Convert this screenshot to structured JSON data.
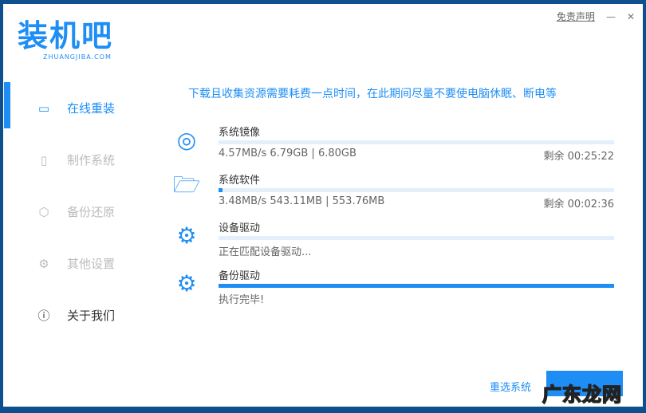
{
  "logo": {
    "text": "装机吧",
    "domain": "ZHUANGJIBA.COM"
  },
  "header": {
    "disclaimer": "免责声明",
    "minimize": "—",
    "close": "✕"
  },
  "sidebar": {
    "items": [
      {
        "label": "在线重装",
        "icon": "monitor-icon"
      },
      {
        "label": "制作系统",
        "icon": "usb-icon"
      },
      {
        "label": "备份还原",
        "icon": "shield-icon"
      },
      {
        "label": "其他设置",
        "icon": "gear-icon"
      },
      {
        "label": "关于我们",
        "icon": "info-icon"
      }
    ]
  },
  "notice": "下载且收集资源需要耗费一点时间，在此期间尽量不要使电脑休眠、断电等",
  "items": [
    {
      "name": "系统镜像",
      "info": "4.57MB/s 6.79GB | 6.80GB",
      "remain": "剩余 00:25:22",
      "progress": 0
    },
    {
      "name": "系统软件",
      "info": "3.48MB/s 543.11MB | 553.76MB",
      "remain": "剩余 00:02:36",
      "progress": 1
    },
    {
      "name": "设备驱动",
      "info": "正在匹配设备驱动...",
      "progress": 0
    },
    {
      "name": "备份驱动",
      "info": "执行完毕!",
      "progress": 100
    }
  ],
  "footer": {
    "reselect": "重选系统",
    "watermark": "广东龙网"
  },
  "colors": {
    "accent": "#1e8ef5"
  }
}
